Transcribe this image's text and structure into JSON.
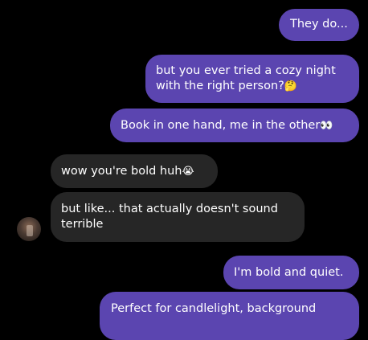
{
  "messages": [
    {
      "id": "m1",
      "side": "sent",
      "text": "They do..."
    },
    {
      "id": "m2",
      "side": "sent",
      "line1": "but you ever tried a cozy night",
      "line2": "with the right person?",
      "emoji": "🤔"
    },
    {
      "id": "m3",
      "side": "sent",
      "text": "Book in one hand, me in the other",
      "emoji": "👀"
    },
    {
      "id": "m4",
      "side": "received",
      "text": "wow you're bold huh",
      "emoji": "😭"
    },
    {
      "id": "m5",
      "side": "received",
      "line1": "but like... that actually doesn't sound",
      "line2": "terrible"
    },
    {
      "id": "m6",
      "side": "sent",
      "text": "I'm bold and quiet."
    },
    {
      "id": "m7",
      "side": "sent",
      "text": "Perfect for candlelight, background"
    }
  ],
  "colors": {
    "sent_bubble": "#5b45b0",
    "received_bubble": "#262626",
    "background": "#000000",
    "text": "#ffffff"
  },
  "avatar": {
    "icon": "contact-avatar"
  }
}
